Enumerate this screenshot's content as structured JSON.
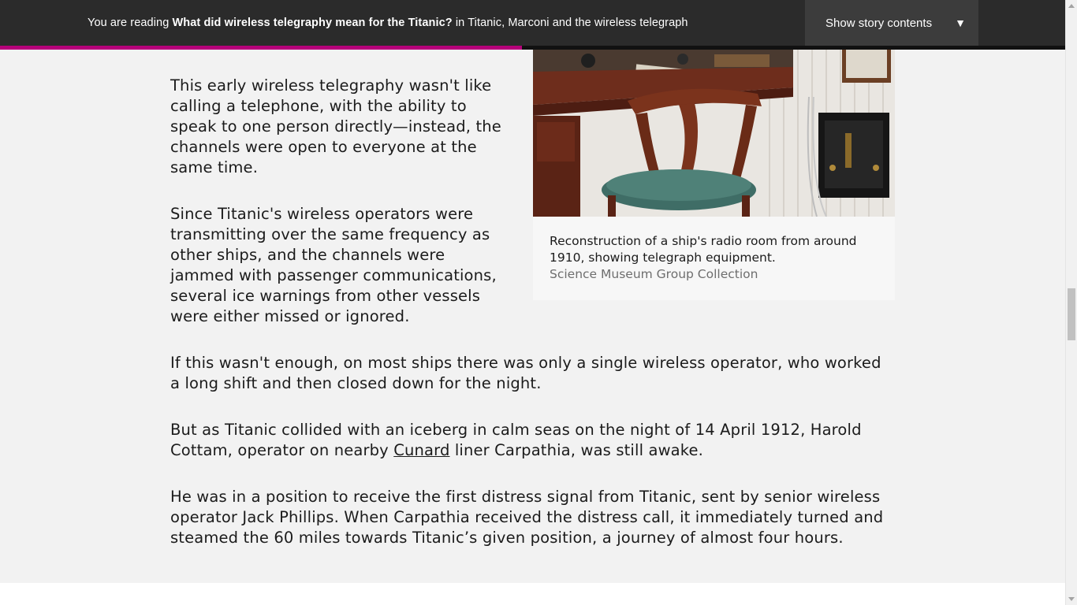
{
  "header": {
    "reading_prefix": "You are reading ",
    "story_title": "What did wireless telegraphy mean for the Titanic?",
    "reading_in": " in Titanic, Marconi and the wireless telegraph",
    "contents_button": "Show story contents",
    "contents_arrow": "▼",
    "progress_fraction": 0.49
  },
  "article": {
    "p1": "This early wireless telegraphy wasn't like calling a telephone, with the ability to speak to one person directly—instead, the channels were open to everyone at the same time.",
    "p2": "Since Titanic's wireless operators were transmitting over the same frequency as other ships, and the channels were jammed with passenger communications, several ice warnings from other vessels were either missed or ignored.",
    "p3": "If this wasn't enough, on most ships there was only a single wireless operator, who worked a long shift and then closed down for the night.",
    "p4_before": "But as Titanic collided with an iceberg in calm seas on the night of 14 April 1912, Harold Cottam, operator on nearby ",
    "p4_link": "Cunard",
    "p4_after": " liner Carpathia, was still awake.",
    "p5": "He was in a position to receive the first distress signal from Titanic, sent by senior wireless operator Jack Phillips. When Carpathia received the distress call, it immediately turned and steamed the 60 miles towards Titanic’s given position, a journey of almost four hours."
  },
  "figure": {
    "caption": "Reconstruction of a ship's radio room from around 1910, showing telegraph equipment.",
    "credit": "Science Museum Group Collection"
  },
  "colors": {
    "header_bg": "#2b2b2b",
    "progress_accent": "#b5007a",
    "page_bg": "#f2f2f2"
  }
}
